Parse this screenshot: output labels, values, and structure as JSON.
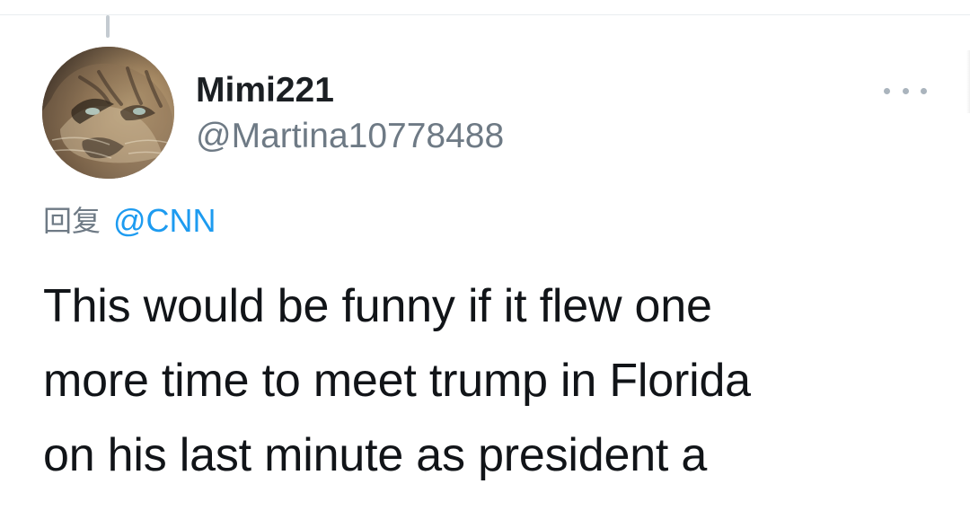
{
  "tweet": {
    "author": {
      "display_name": "Mimi221",
      "handle": "@Martina10778488",
      "avatar": "cat-avatar-icon"
    },
    "reply_to": {
      "label": "回复",
      "mention": "@CNN"
    },
    "text_lines": [
      "This would be funny if it flew one",
      "more time to meet trump in Florida",
      "on his last minute as president a"
    ]
  },
  "actions": {
    "more_icon": "more-horizontal-icon"
  },
  "colors": {
    "mention": "#1d9bf0",
    "secondary_text": "#6e7a85",
    "primary_text": "#111418",
    "divider": "#e9edf0"
  }
}
